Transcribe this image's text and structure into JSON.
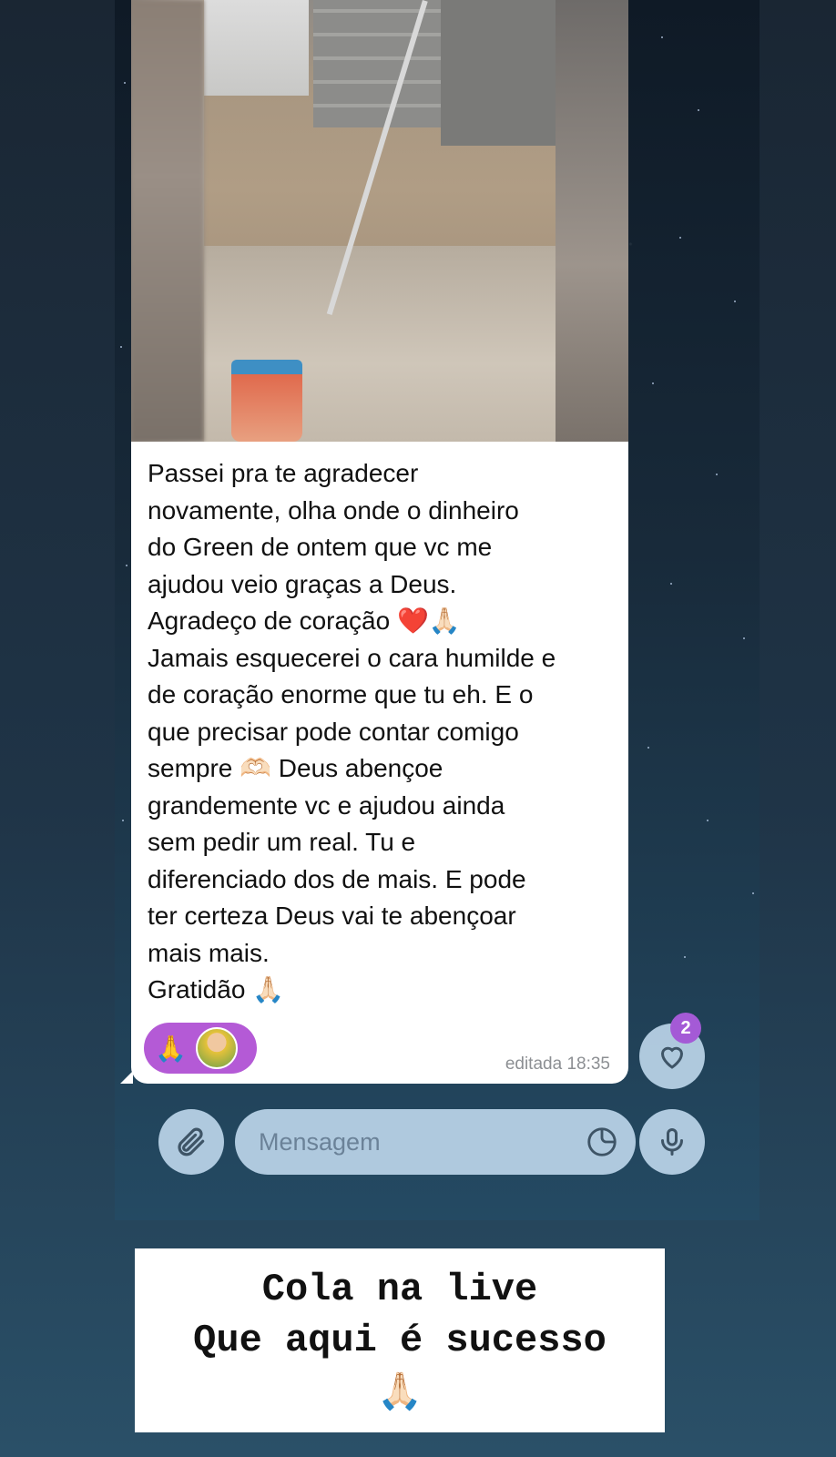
{
  "message": {
    "text": "Passei pra te agradecer\nnovamente, olha onde o dinheiro\ndo Green de ontem que vc me\najudou veio graças a Deus.\nAgradeço de coração ❤️🙏🏻\nJamais esquecerei o cara humilde e\nde coração enorme que tu eh. E o\nque precisar pode contar comigo\nsempre 🫶🏻 Deus abençoe\ngrandemente vc e ajudou ainda\nsem pedir um real. Tu e\ndiferenciado dos de mais. E pode\nter certeza Deus vai te abençoar\nmais mais.\nGratidão 🙏🏻",
    "timestamp": "editada 18:35",
    "reaction_emoji": "🙏",
    "reaction_count_badge": "2"
  },
  "composer": {
    "placeholder": "Mensagem"
  },
  "story_caption": {
    "line1": "Cola na live",
    "line2": "Que aqui é sucesso",
    "emoji": "🙏🏻"
  },
  "colors": {
    "reaction_pill": "#b45ad6",
    "badge": "#a45ad6",
    "composer_bg": "#c8e1f5"
  },
  "icons": {
    "attach": "paperclip-icon",
    "sticker": "sticker-icon",
    "mic": "microphone-icon",
    "heart": "heart-icon"
  }
}
